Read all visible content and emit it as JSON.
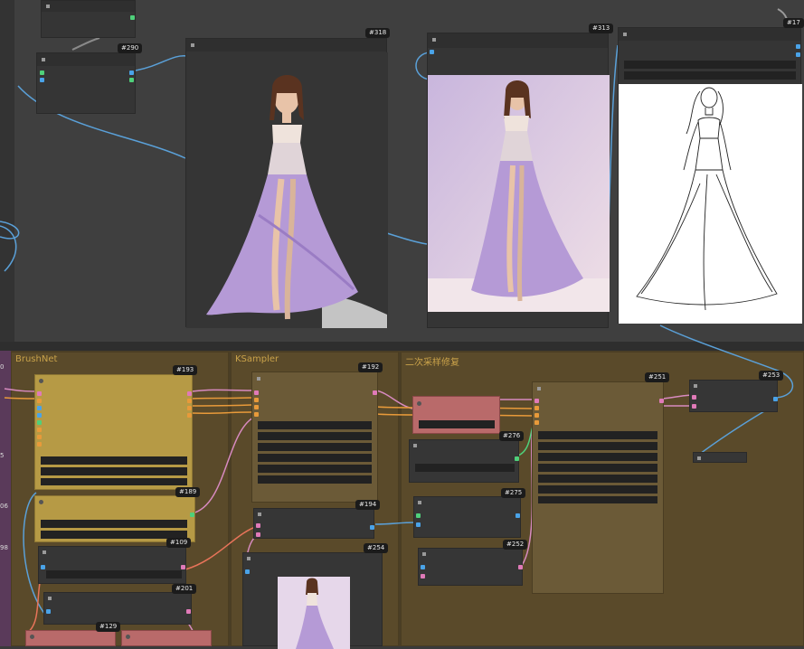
{
  "colors": {
    "canvas": "#3f3f3f",
    "group_bg": "#5a4a2a",
    "group_title": "#c9a24a",
    "yellow_node": "#b69a45",
    "red_node": "#b96a6a",
    "link_blue": "#5aa0d8",
    "link_pink": "#d88ac0",
    "link_orange": "#e89a3a",
    "port_green": "#4fd07a",
    "port_blue": "#4aa3e8",
    "port_pink": "#e07ab8",
    "port_orange": "#f0a030"
  },
  "top_nodes": {
    "n290": "#290",
    "n318": "#318",
    "n313": "#313",
    "n17": "#17"
  },
  "groups": {
    "brushnet": "BrushNet",
    "ksampler": "KSampler",
    "resample": "二次采样修复"
  },
  "bottom_nodes": {
    "n193": "#193",
    "n189": "#189",
    "n109": "#109",
    "n201": "#201",
    "n129": "#129",
    "n192": "#192",
    "n194": "#194",
    "n254": "#254",
    "n276": "#276",
    "n275": "#275",
    "n252": "#252",
    "n251": "#251",
    "n253": "#253"
  },
  "left_edge_labels": [
    "0",
    "5",
    "06",
    "98"
  ],
  "icons": [
    "dress-model-image",
    "studio-model-image",
    "line-sketch-image",
    "preview-thumbnail-image"
  ]
}
